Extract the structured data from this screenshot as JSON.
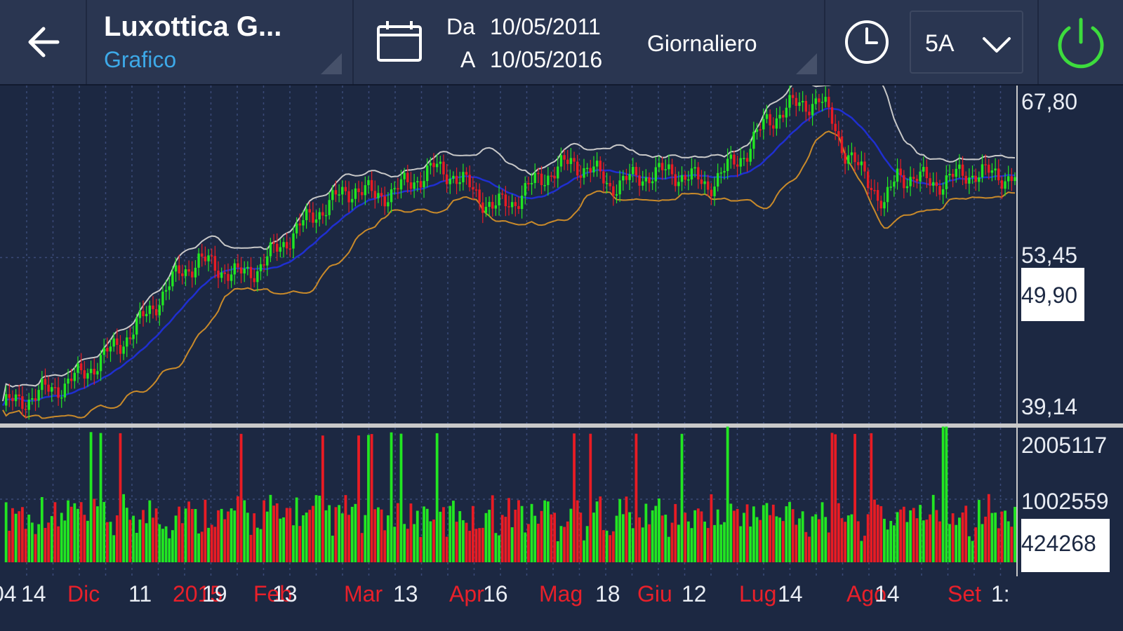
{
  "header": {
    "back_icon": "arrow-left-icon",
    "title": "Luxottica G...",
    "subtitle": "Grafico",
    "calendar_icon": "calendar-icon",
    "from_label": "Da",
    "from_date": "10/05/2011",
    "to_label": "A",
    "to_date": "10/05/2016",
    "frequency": "Giornaliero",
    "clock_icon": "clock-icon",
    "period": "5A",
    "period_icon": "chevron-down-icon",
    "power_icon": "power-icon"
  },
  "colors": {
    "background": "#1c2842",
    "toolbar": "#2a3651",
    "up": "#22e622",
    "down": "#e81c24",
    "ma": "#1f2fd0",
    "upper_band": "#c8c8c8",
    "lower_band": "#c98a2a",
    "accent": "#3da9e8",
    "power": "#3ddc3d"
  },
  "chart_data": [
    {
      "type": "candlestick",
      "name": "price",
      "indicators": [
        "moving average",
        "upper Bollinger band",
        "lower Bollinger band"
      ],
      "ylim": [
        39.14,
        67.8
      ],
      "y_ticks": [
        "67,80",
        "53,45",
        "39,14"
      ],
      "current_value_label": "49,90",
      "current_value": 49.9,
      "x_tick_labels": [
        {
          "text": "04",
          "highlight": false
        },
        {
          "text": "14",
          "highlight": false
        },
        {
          "text": "Dic",
          "highlight": true
        },
        {
          "text": "11",
          "highlight": false
        },
        {
          "text": "2015",
          "highlight": true
        },
        {
          "text": "19",
          "highlight": false
        },
        {
          "text": "Feb",
          "highlight": true
        },
        {
          "text": "13",
          "highlight": false
        },
        {
          "text": "Mar",
          "highlight": true
        },
        {
          "text": "13",
          "highlight": false
        },
        {
          "text": "Apr",
          "highlight": true
        },
        {
          "text": "16",
          "highlight": false
        },
        {
          "text": "Mag",
          "highlight": true
        },
        {
          "text": "18",
          "highlight": false
        },
        {
          "text": "Giu",
          "highlight": true
        },
        {
          "text": "12",
          "highlight": false
        },
        {
          "text": "Lug",
          "highlight": true
        },
        {
          "text": "14",
          "highlight": false
        },
        {
          "text": "Ago",
          "highlight": true
        },
        {
          "text": "14",
          "highlight": false
        },
        {
          "text": "Set",
          "highlight": true
        },
        {
          "text": "1:",
          "highlight": false
        }
      ],
      "close_path": [
        [
          0,
          40.0
        ],
        [
          6,
          40.5
        ],
        [
          12,
          41.2
        ],
        [
          18,
          41.8
        ],
        [
          24,
          42.8
        ],
        [
          30,
          44.2
        ],
        [
          36,
          45.7
        ],
        [
          42,
          47.5
        ],
        [
          48,
          49.8
        ],
        [
          54,
          52.0
        ],
        [
          60,
          53.2
        ],
        [
          66,
          52.5
        ],
        [
          72,
          51.8
        ],
        [
          78,
          52.5
        ],
        [
          84,
          54.2
        ],
        [
          90,
          56.0
        ],
        [
          96,
          57.5
        ],
        [
          102,
          58.8
        ],
        [
          108,
          59.8
        ],
        [
          114,
          59.0
        ],
        [
          120,
          59.5
        ],
        [
          126,
          60.5
        ],
        [
          132,
          61.5
        ],
        [
          138,
          61.0
        ],
        [
          144,
          59.5
        ],
        [
          150,
          58.0
        ],
        [
          156,
          58.5
        ],
        [
          162,
          60.0
        ],
        [
          168,
          61.3
        ],
        [
          174,
          62.0
        ],
        [
          180,
          61.5
        ],
        [
          186,
          60.0
        ],
        [
          192,
          60.5
        ],
        [
          198,
          61.0
        ],
        [
          204,
          61.2
        ],
        [
          210,
          60.8
        ],
        [
          216,
          60.0
        ],
        [
          222,
          61.5
        ],
        [
          228,
          63.2
        ],
        [
          234,
          65.8
        ],
        [
          240,
          67.0
        ],
        [
          246,
          67.5
        ],
        [
          250,
          67.7
        ],
        [
          254,
          66.0
        ],
        [
          258,
          63.0
        ],
        [
          262,
          61.5
        ],
        [
          266,
          60.3
        ],
        [
          270,
          58.0
        ],
        [
          274,
          61.0
        ],
        [
          280,
          60.6
        ],
        [
          286,
          60.2
        ],
        [
          292,
          60.8
        ],
        [
          298,
          61.2
        ],
        [
          304,
          60.9
        ],
        [
          310,
          60.8
        ]
      ]
    },
    {
      "type": "bar",
      "name": "volume",
      "y_ticks": [
        "2005117",
        "1002559"
      ],
      "ylim": [
        0,
        2005117
      ],
      "current_value_label": "424268",
      "current_value": 424268
    }
  ]
}
